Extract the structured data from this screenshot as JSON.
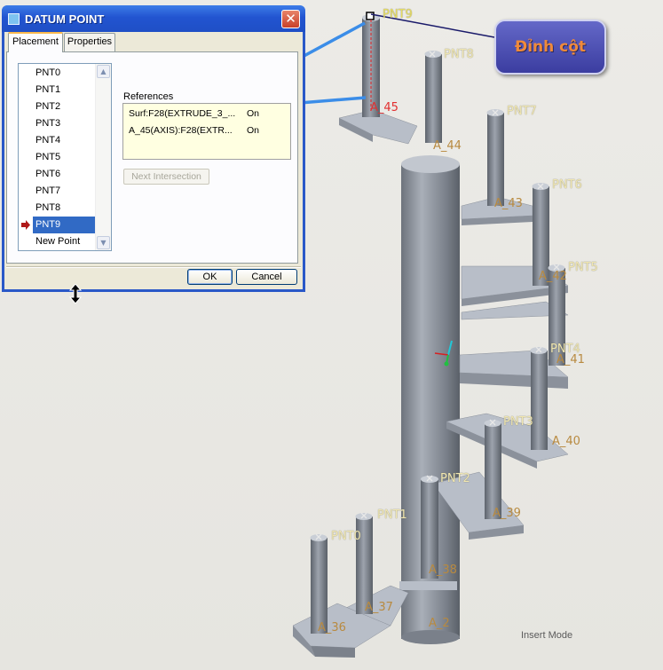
{
  "dialog": {
    "title": "DATUM POINT",
    "close_glyph": "✕",
    "tabs": [
      {
        "label": "Placement",
        "active": true
      },
      {
        "label": "Properties",
        "active": false
      }
    ],
    "points": [
      "PNT0",
      "PNT1",
      "PNT2",
      "PNT3",
      "PNT4",
      "PNT5",
      "PNT6",
      "PNT7",
      "PNT8",
      "PNT9",
      "New Point"
    ],
    "selected_point": "PNT9",
    "references_label": "References",
    "references": [
      {
        "name": "Surf:F28(EXTRUDE_3_...",
        "state": "On"
      },
      {
        "name": "A_45(AXIS):F28(EXTR...",
        "state": "On"
      }
    ],
    "next_intersection_label": "Next Intersection",
    "ok_label": "OK",
    "cancel_label": "Cancel"
  },
  "viewport": {
    "callout_text": "Đỉnh cột",
    "mode_text": "Insert Mode",
    "point_labels": [
      "PNT0",
      "PNT1",
      "PNT2",
      "PNT3",
      "PNT4",
      "PNT5",
      "PNT6",
      "PNT7",
      "PNT8",
      "PNT9"
    ],
    "axis_labels": [
      "A_36",
      "A_37",
      "A_38",
      "A_39",
      "A_40",
      "A_41",
      "A_42",
      "A_43",
      "A_44",
      "A_45",
      "A_2"
    ]
  },
  "colors": {
    "title_bar": "#2254d0",
    "selection": "#316ac5",
    "model_gray": "#aab0bb",
    "callout_bg": "#4448b0",
    "callout_text": "#f08a3a",
    "arrow": "#3b8de8"
  }
}
